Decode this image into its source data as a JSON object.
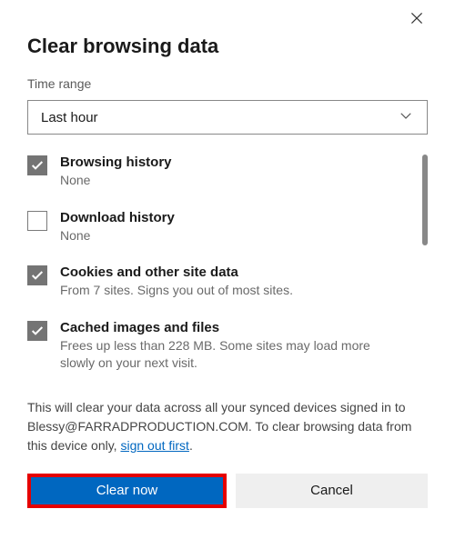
{
  "title": "Clear browsing data",
  "time_range_label": "Time range",
  "time_range_value": "Last hour",
  "options": [
    {
      "checked": true,
      "label": "Browsing history",
      "desc": "None"
    },
    {
      "checked": false,
      "label": "Download history",
      "desc": "None"
    },
    {
      "checked": true,
      "label": "Cookies and other site data",
      "desc": "From 7 sites. Signs you out of most sites."
    },
    {
      "checked": true,
      "label": "Cached images and files",
      "desc": "Frees up less than 228 MB. Some sites may load more slowly on your next visit."
    }
  ],
  "footer_part1": "This will clear your data across all your synced devices signed in to Blessy@FARRADPRODUCTION.COM. To clear browsing data from this device only, ",
  "footer_link": "sign out first",
  "footer_part2": ".",
  "buttons": {
    "primary": "Clear now",
    "secondary": "Cancel"
  }
}
